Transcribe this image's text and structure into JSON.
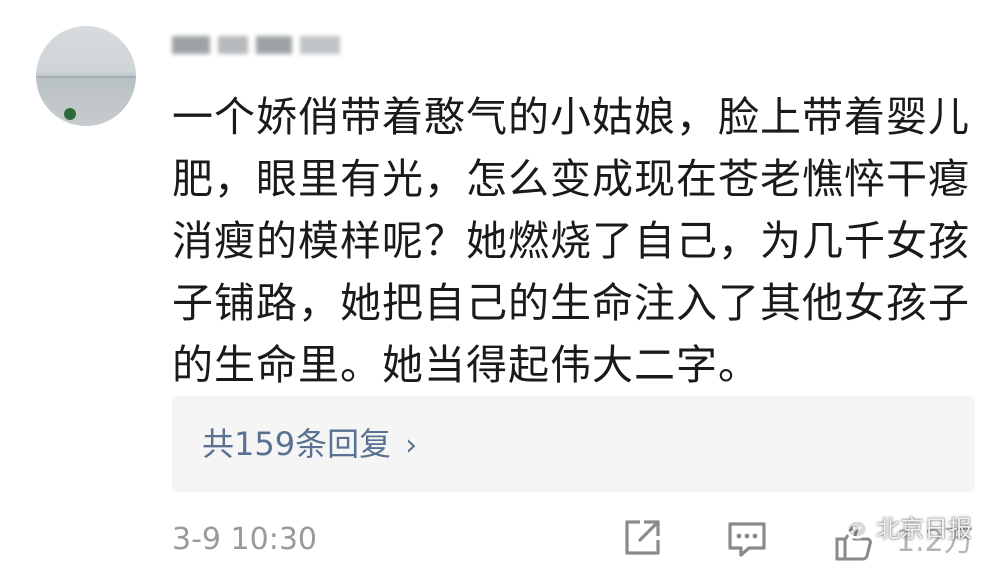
{
  "comment": {
    "text": "一个娇俏带着憨气的小姑娘，脸上带着婴儿\n肥，眼里有光，怎么变成现在苍老憔悴干瘪\n消瘦的模样呢？她燃烧了自己，为几千女孩\n子铺路，她把自己的生命注入了其他女孩子\n的生命里。她当得起伟大二字。"
  },
  "replies": {
    "label": "共159条回复",
    "chevron": "›"
  },
  "footer": {
    "timestamp": "3-9 10:30",
    "like_count": "1.2万"
  },
  "icons": {
    "share": "share-icon",
    "comment": "comment-icon",
    "like": "thumbs-up-icon",
    "watermark": "wechat-icon"
  },
  "watermark": {
    "text": "北京日报"
  },
  "colors": {
    "reply_link": "#5a7291",
    "meta_text": "#9a9a9a",
    "reply_bg": "#f5f5f5"
  }
}
